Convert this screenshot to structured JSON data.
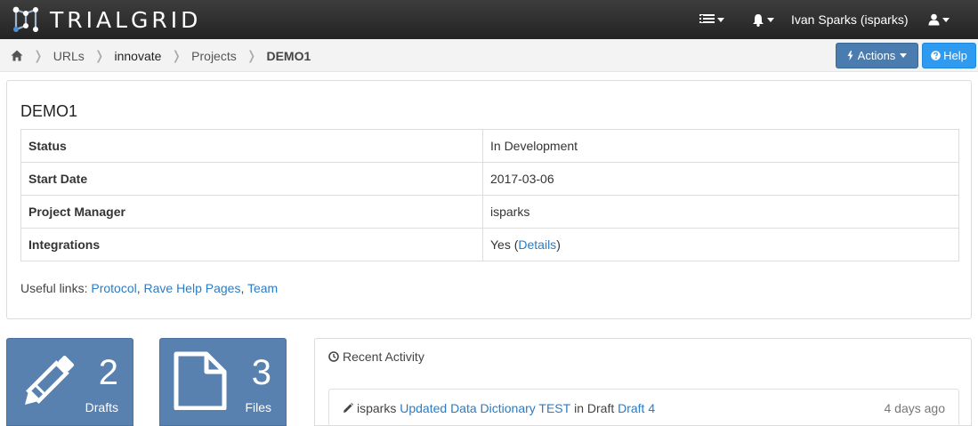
{
  "navbar": {
    "brand": "TRIALGRID",
    "user_label": "Ivan Sparks (isparks)",
    "icons": [
      "menu-list-icon",
      "bell-icon",
      "user-icon"
    ]
  },
  "breadcrumb": {
    "items": [
      "URLs",
      "innovate",
      "Projects"
    ],
    "current": "DEMO1"
  },
  "toolbar": {
    "actions_label": "Actions",
    "help_label": "Help"
  },
  "project": {
    "title": "DEMO1",
    "rows": [
      {
        "key": "Status",
        "value": "In Development"
      },
      {
        "key": "Start Date",
        "value": "2017-03-06"
      },
      {
        "key": "Project Manager",
        "value": "isparks"
      },
      {
        "key": "Integrations",
        "value_prefix": "Yes (",
        "link": "Details",
        "value_suffix": ")"
      }
    ],
    "useful_links_label": "Useful links:",
    "useful_links": [
      "Protocol",
      "Rave Help Pages",
      "Team"
    ]
  },
  "tiles": [
    {
      "count": "2",
      "label": "Drafts",
      "icon": "pencil-icon"
    },
    {
      "count": "3",
      "label": "Files",
      "icon": "file-icon"
    }
  ],
  "activity": {
    "title": "Recent Activity",
    "items": [
      {
        "user": "isparks",
        "action_link": "Updated Data Dictionary TEST",
        "middle": "in Draft",
        "target_link": "Draft 4",
        "time": "4 days ago"
      }
    ]
  },
  "colors": {
    "navbar": "#2d2d2d",
    "tile": "#5881b0",
    "link": "#2a7cc7",
    "actions_button": "#4a7cb0",
    "help_button": "#2e9af0"
  }
}
